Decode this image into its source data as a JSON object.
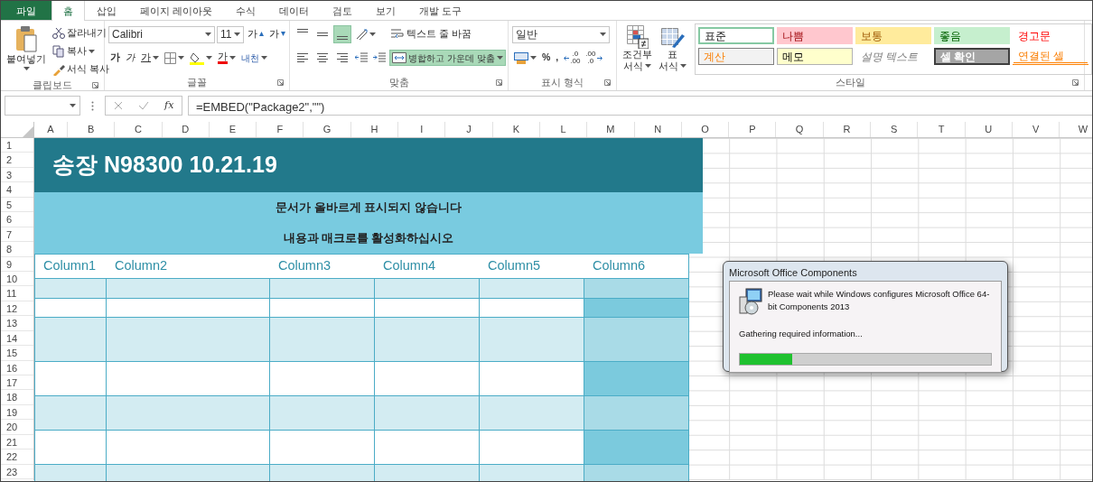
{
  "tabs": [
    {
      "label": "파일",
      "kind": "file",
      "selected": false
    },
    {
      "label": "홈",
      "kind": "tab",
      "selected": true
    },
    {
      "label": "삽입",
      "kind": "tab",
      "selected": false
    },
    {
      "label": "페이지 레이아웃",
      "kind": "tab",
      "selected": false
    },
    {
      "label": "수식",
      "kind": "tab",
      "selected": false
    },
    {
      "label": "데이터",
      "kind": "tab",
      "selected": false
    },
    {
      "label": "검토",
      "kind": "tab",
      "selected": false
    },
    {
      "label": "보기",
      "kind": "tab",
      "selected": false
    },
    {
      "label": "개발 도구",
      "kind": "tab",
      "selected": false
    }
  ],
  "clipboard": {
    "label": "클립보드",
    "paste": "붙여넣기",
    "items": [
      {
        "label": "잘라내기",
        "kind": "cut"
      },
      {
        "label": "복사",
        "kind": "copy"
      },
      {
        "label": "서식 복사",
        "kind": "painter"
      }
    ]
  },
  "font": {
    "label": "글꼴",
    "family": "Calibri",
    "size": "11",
    "grow": "가",
    "shrink": "가",
    "bold": "가",
    "italic": "가",
    "underline": "가",
    "font_color": "가",
    "phonetic": "내천"
  },
  "alignment": {
    "label": "맞춤",
    "vertical": [
      {
        "kind": "top",
        "selected": false
      },
      {
        "kind": "middle",
        "selected": false
      },
      {
        "kind": "bottom",
        "selected": true
      }
    ],
    "horizontal": [
      {
        "kind": "left",
        "selected": false
      },
      {
        "kind": "center",
        "selected": false
      },
      {
        "kind": "right",
        "selected": false
      }
    ],
    "wrap": {
      "label": "텍스트 줄 바꿈",
      "selected": false
    },
    "merge": {
      "label": "병합하고 가운데 맞춤",
      "selected": true
    }
  },
  "number": {
    "label": "표시 형식",
    "format": "일반",
    "percent": "%",
    "comma": ",",
    "decimals": [
      {
        "kind": "increase",
        "top": ".0",
        "bottom": ".00"
      },
      {
        "kind": "decrease",
        "top": ".00",
        "bottom": ".0"
      }
    ]
  },
  "styles": {
    "label": "스타일",
    "conditional": [
      "조건부",
      "서식"
    ],
    "table_format": [
      "표",
      "서식"
    ],
    "cells": [
      {
        "label": "표준",
        "kind": "normal",
        "selected": true
      },
      {
        "label": "나쁨",
        "kind": "bad",
        "selected": false
      },
      {
        "label": "보통",
        "kind": "neutral",
        "selected": false
      },
      {
        "label": "좋음",
        "kind": "good",
        "selected": false
      },
      {
        "label": "경고문",
        "kind": "warning",
        "selected": false
      },
      {
        "label": "계산",
        "kind": "calculation",
        "selected": false
      },
      {
        "label": "메모",
        "kind": "note",
        "selected": false
      },
      {
        "label": "설명 텍스트",
        "kind": "explanatory",
        "selected": false
      },
      {
        "label": "셀 확인",
        "kind": "check",
        "selected": false
      },
      {
        "label": "연결된 셀",
        "kind": "linked",
        "selected": false
      }
    ]
  },
  "formula_bar": {
    "fx": "fx",
    "formula": "=EMBED(\"Package2\",\"\")"
  },
  "sheet": {
    "columns": [
      "A",
      "B",
      "C",
      "D",
      "E",
      "F",
      "G",
      "H",
      "I",
      "J",
      "K",
      "L",
      "M",
      "N",
      "O",
      "P",
      "Q",
      "R",
      "S",
      "T",
      "U",
      "V",
      "W"
    ],
    "rows": [
      "1",
      "2",
      "3",
      "4",
      "5",
      "6",
      "7",
      "8",
      "9",
      "10",
      "11",
      "12",
      "13",
      "14",
      "15",
      "16",
      "17",
      "18",
      "19",
      "20",
      "21",
      "22",
      "23"
    ],
    "title": "송장 N98300 10.21.19",
    "notices": [
      "문서가 올바르게 표시되지 않습니다",
      "내용과 매크로를 활성화하십시오"
    ],
    "table_columns": [
      "Column1",
      "Column2",
      "Column3",
      "Column4",
      "Column5",
      "Column6"
    ]
  },
  "dialog": {
    "title": "Microsoft Office Components",
    "message": "Please wait while Windows configures Microsoft Office 64-bit Components 2013",
    "status": "Gathering required information...",
    "progress": {
      "level": 0.21
    }
  }
}
